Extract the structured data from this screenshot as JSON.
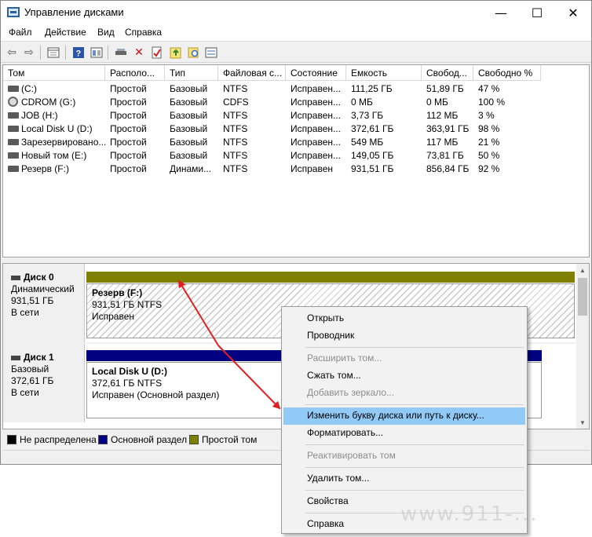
{
  "window": {
    "title": "Управление дисками",
    "minimize": "—",
    "maximize": "☐",
    "close": "✕"
  },
  "menu": [
    "Файл",
    "Действие",
    "Вид",
    "Справка"
  ],
  "toolbar": {
    "icons": [
      "back-icon",
      "forward-icon",
      "properties-icon",
      "help-icon",
      "view-icon",
      "connect-icon",
      "delete-icon",
      "check-icon",
      "refresh-icon",
      "search-icon",
      "list-icon"
    ]
  },
  "table": {
    "columns": [
      "Том",
      "Располо...",
      "Тип",
      "Файловая с...",
      "Состояние",
      "Емкость",
      "Свобод...",
      "Свободно %"
    ],
    "rows": [
      {
        "icon": "disk",
        "cells": [
          "(C:)",
          "Простой",
          "Базовый",
          "NTFS",
          "Исправен...",
          "111,25 ГБ",
          "51,89 ГБ",
          "47 %"
        ]
      },
      {
        "icon": "cd",
        "cells": [
          "CDROM (G:)",
          "Простой",
          "Базовый",
          "CDFS",
          "Исправен...",
          "0 МБ",
          "0 МБ",
          "100 %"
        ]
      },
      {
        "icon": "disk",
        "cells": [
          "JOB (H:)",
          "Простой",
          "Базовый",
          "NTFS",
          "Исправен...",
          "3,73 ГБ",
          "112 МБ",
          "3 %"
        ]
      },
      {
        "icon": "disk",
        "cells": [
          "Local Disk U (D:)",
          "Простой",
          "Базовый",
          "NTFS",
          "Исправен...",
          "372,61 ГБ",
          "363,91 ГБ",
          "98 %"
        ]
      },
      {
        "icon": "disk",
        "cells": [
          "Зарезервировано...",
          "Простой",
          "Базовый",
          "NTFS",
          "Исправен...",
          "549 МБ",
          "117 МБ",
          "21 %"
        ]
      },
      {
        "icon": "disk",
        "cells": [
          "Новый том (E:)",
          "Простой",
          "Базовый",
          "NTFS",
          "Исправен...",
          "149,05 ГБ",
          "73,81 ГБ",
          "50 %"
        ]
      },
      {
        "icon": "disk",
        "cells": [
          "Резерв (F:)",
          "Простой",
          "Динами...",
          "NTFS",
          "Исправен",
          "931,51 ГБ",
          "856,84 ГБ",
          "92 %"
        ]
      }
    ]
  },
  "disks": [
    {
      "name": "Диск 0",
      "type": "Динамический",
      "size": "931,51 ГБ",
      "status": "В сети",
      "volume": {
        "name": "Резерв  (F:)",
        "size": "931,51 ГБ NTFS",
        "status": "Исправен"
      }
    },
    {
      "name": "Диск 1",
      "type": "Базовый",
      "size": "372,61 ГБ",
      "status": "В сети",
      "volume": {
        "name": "Local Disk U  (D:)",
        "size": "372,61 ГБ NTFS",
        "status": "Исправен (Основной раздел)"
      }
    }
  ],
  "legend": [
    {
      "label": "Не распределена",
      "color": "#000000"
    },
    {
      "label": "Основной раздел",
      "color": "#000080"
    },
    {
      "label": "Простой том",
      "color": "#808000"
    }
  ],
  "context_menu": {
    "open": "Открыть",
    "explorer": "Проводник",
    "extend": "Расширить том...",
    "shrink": "Сжать том...",
    "mirror": "Добавить зеркало...",
    "change_letter": "Изменить букву диска или путь к диску...",
    "format": "Форматировать...",
    "reactivate": "Реактивировать том",
    "delete": "Удалить том...",
    "properties": "Свойства",
    "help": "Справка"
  },
  "colors": {
    "simple_volume": "#808000",
    "primary_partition": "#000080",
    "highlight": "#91c9f7",
    "arrow": "#e02020"
  },
  "watermark": "www.911-..."
}
